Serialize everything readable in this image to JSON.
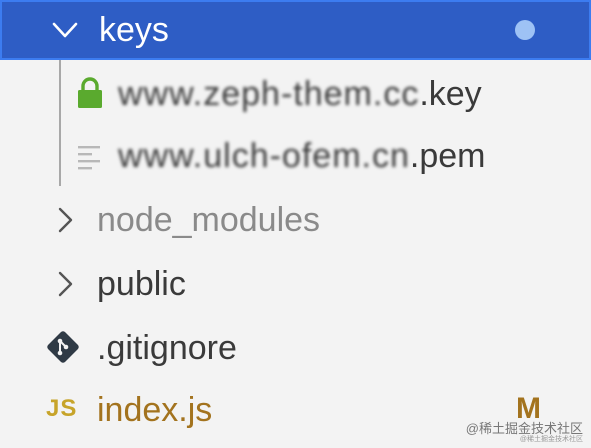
{
  "explorer": {
    "folder": {
      "name": "keys",
      "expanded": true
    },
    "children": [
      {
        "prefix": "www.zeph-them.cc",
        "ext": ".key",
        "icon": "lock-icon"
      },
      {
        "prefix": "www.ulch-ofem.cn",
        "ext": ".pem",
        "icon": "text-file-icon"
      }
    ],
    "items": [
      {
        "name": "node_modules",
        "type": "folder",
        "dimmed": true
      },
      {
        "name": "public",
        "type": "folder"
      },
      {
        "name": ".gitignore",
        "type": "git-file"
      },
      {
        "name": "index.js",
        "type": "js-file",
        "badge": "M"
      }
    ],
    "js_icon_text": "JS"
  },
  "colors": {
    "selection_bg": "#2e5dc5",
    "selection_border": "#3c7cf0",
    "modified": "#a3731e",
    "lock": "#5aaa2e"
  },
  "watermark": {
    "line1": "@稀土掘金技术社区",
    "line2": "@稀土掘金技术社区"
  }
}
